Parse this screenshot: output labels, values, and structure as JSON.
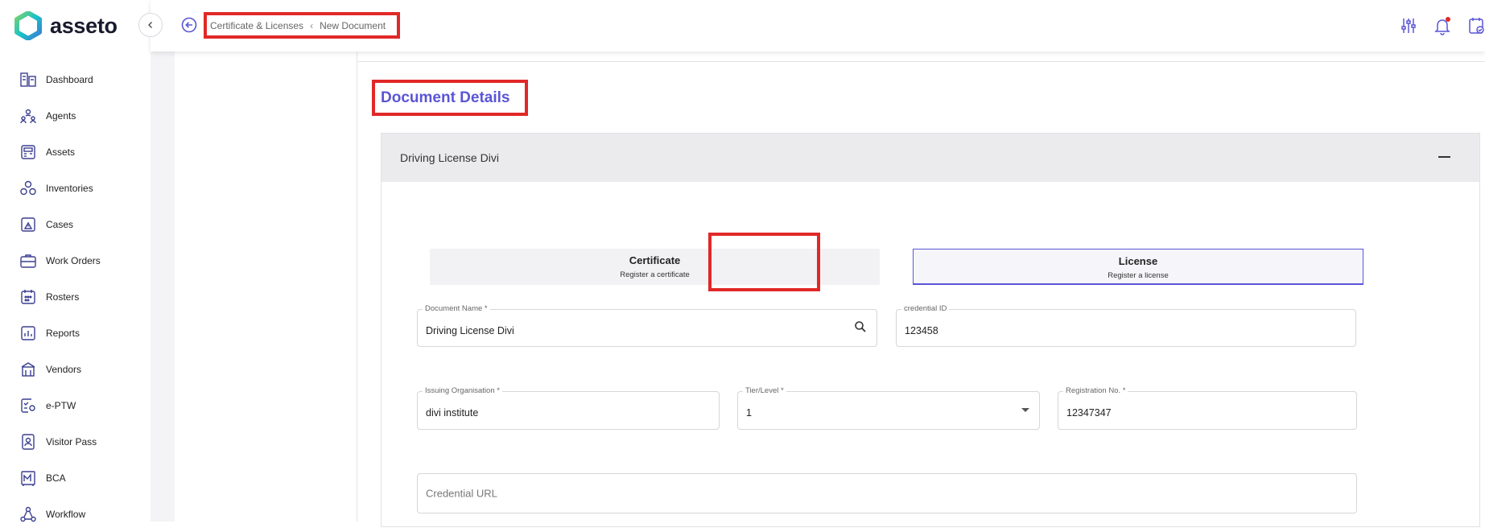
{
  "app": {
    "name": "asseto"
  },
  "sidebar": {
    "items": [
      {
        "label": "Dashboard",
        "icon": "dashboard-icon"
      },
      {
        "label": "Agents",
        "icon": "agents-icon"
      },
      {
        "label": "Assets",
        "icon": "assets-icon"
      },
      {
        "label": "Inventories",
        "icon": "inventories-icon"
      },
      {
        "label": "Cases",
        "icon": "cases-icon"
      },
      {
        "label": "Work Orders",
        "icon": "work-orders-icon"
      },
      {
        "label": "Rosters",
        "icon": "rosters-icon"
      },
      {
        "label": "Reports",
        "icon": "reports-icon"
      },
      {
        "label": "Vendors",
        "icon": "vendors-icon"
      },
      {
        "label": "e-PTW",
        "icon": "eptw-icon"
      },
      {
        "label": "Visitor Pass",
        "icon": "visitor-pass-icon"
      },
      {
        "label": "BCA",
        "icon": "bca-icon"
      },
      {
        "label": "Workflow",
        "icon": "workflow-icon"
      }
    ]
  },
  "header": {
    "breadcrumb": {
      "parent": "Certificate & Licenses",
      "current": "New Document"
    }
  },
  "page": {
    "title": "Document Details"
  },
  "accordion": {
    "title": "Driving License Divi"
  },
  "tabs": {
    "certificate": {
      "title": "Certificate",
      "subtitle": "Register a certificate"
    },
    "license": {
      "title": "License",
      "subtitle": "Register a license"
    }
  },
  "form": {
    "document_name": {
      "label": "Document Name *",
      "value": "Driving License Divi"
    },
    "credential_id": {
      "label": "credential ID",
      "value": "123458"
    },
    "issuing_org": {
      "label": "Issuing Organisation *",
      "value": "divi institute"
    },
    "tier_level": {
      "label": "Tier/Level *",
      "value": "1"
    },
    "registration_no": {
      "label": "Registration No. *",
      "value": "12347347"
    },
    "credential_url": {
      "placeholder": "Credential URL"
    }
  },
  "colors": {
    "accent": "#5a55d6",
    "highlight": "#e12828",
    "logo_teal": "#19c2c9",
    "logo_blue": "#3a7bd5"
  }
}
